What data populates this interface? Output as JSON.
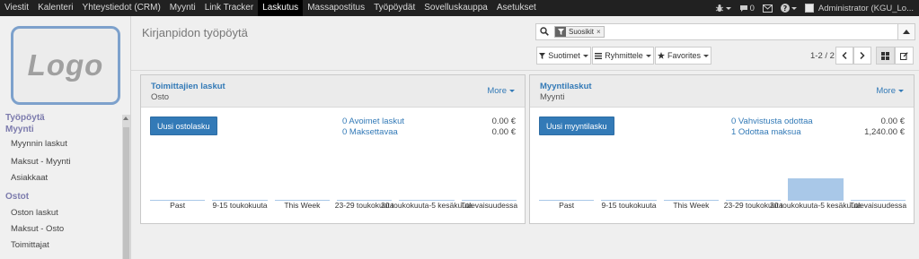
{
  "topbar": {
    "menu": [
      "Viestit",
      "Kalenteri",
      "Yhteystiedot (CRM)",
      "Myynti",
      "Link Tracker",
      "Laskutus",
      "Massapostitus",
      "Työpöydät",
      "Sovelluskauppa",
      "Asetukset"
    ],
    "active": "Laskutus",
    "chat_count": "0",
    "user_label": "Administrator (KGU_Lo..."
  },
  "sidebar": {
    "logo_text": "Logo",
    "sections": [
      {
        "title": "Työpöytä",
        "items": []
      },
      {
        "title": "Myynti",
        "items": [
          "Myynnin laskut",
          "Maksut - Myynti",
          "Asiakkaat"
        ]
      },
      {
        "title": "Ostot",
        "items": [
          "Oston laskut",
          "Maksut - Osto",
          "Toimittajat"
        ]
      }
    ]
  },
  "control": {
    "title": "Kirjanpidon työpöytä",
    "facet": "Suosikit",
    "filters_label": "Suotimet",
    "groupby_label": "Ryhmittele",
    "favorites_label": "Favorites",
    "pager": "1-2 / 2"
  },
  "cards": [
    {
      "title": "Toimittajien laskut",
      "subtitle": "Osto",
      "more": "More",
      "button": "Uusi ostolasku",
      "stats": [
        {
          "label": "0 Avoimet laskut",
          "value": "0.00 €"
        },
        {
          "label": "0 Maksettavaa",
          "value": "0.00 €"
        }
      ],
      "graph_labels": [
        "Past",
        "9-15 toukokuuta",
        "This Week",
        "23-29 toukokuuta",
        "30 toukokuuta-5 kesäkuuta",
        "Tulevaisuudessa"
      ],
      "graph_values": [
        0,
        0,
        0,
        0,
        0,
        0
      ]
    },
    {
      "title": "Myyntilaskut",
      "subtitle": "Myynti",
      "more": "More",
      "button": "Uusi myyntilasku",
      "stats": [
        {
          "label": "0 Vahvistusta odottaa",
          "value": "0.00 €"
        },
        {
          "label": "1 Odottaa maksua",
          "value": "1,240.00 €"
        }
      ],
      "graph_labels": [
        "Past",
        "9-15 toukokuuta",
        "This Week",
        "23-29 toukokuuta",
        "30 toukokuuta-5 kesäkuuta",
        "Tulevaisuudessa"
      ],
      "graph_values": [
        0,
        0,
        0,
        0,
        1240,
        0
      ]
    }
  ]
}
